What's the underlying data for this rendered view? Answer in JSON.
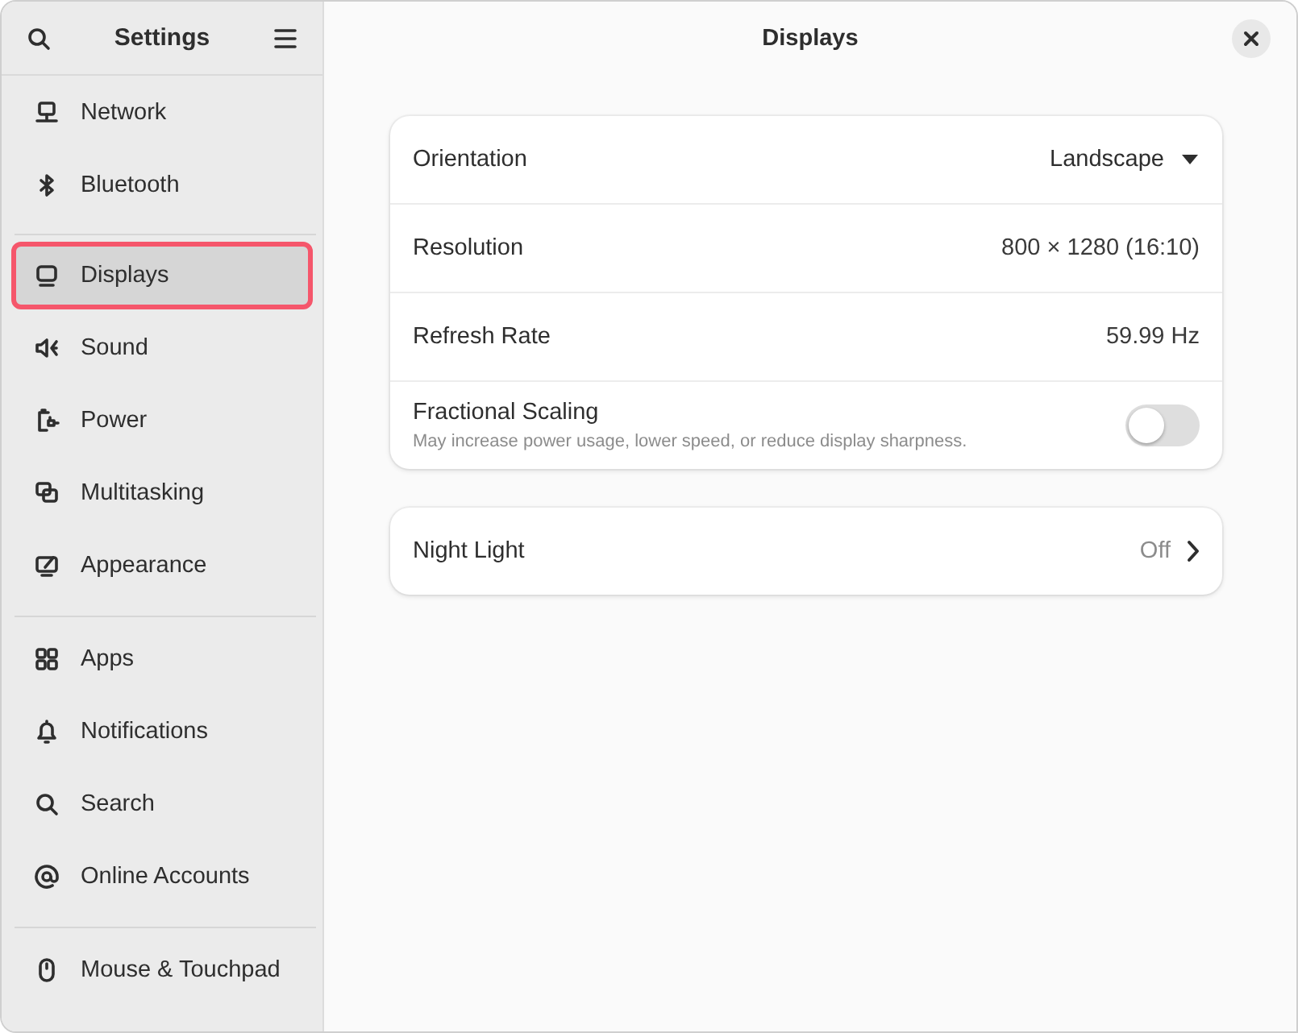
{
  "sidebar": {
    "title": "Settings",
    "groups": [
      {
        "items": [
          {
            "label": "Network",
            "selected": false
          },
          {
            "label": "Bluetooth",
            "selected": false
          }
        ]
      },
      {
        "items": [
          {
            "label": "Displays",
            "selected": true
          },
          {
            "label": "Sound",
            "selected": false
          },
          {
            "label": "Power",
            "selected": false
          },
          {
            "label": "Multitasking",
            "selected": false
          },
          {
            "label": "Appearance",
            "selected": false
          }
        ]
      },
      {
        "items": [
          {
            "label": "Apps",
            "selected": false
          },
          {
            "label": "Notifications",
            "selected": false
          },
          {
            "label": "Search",
            "selected": false
          },
          {
            "label": "Online Accounts",
            "selected": false
          }
        ]
      },
      {
        "items": [
          {
            "label": "Mouse & Touchpad",
            "selected": false
          }
        ]
      }
    ]
  },
  "content": {
    "title": "Displays",
    "cards": [
      {
        "rows": [
          {
            "kind": "dropdown",
            "label": "Orientation",
            "value": "Landscape"
          },
          {
            "kind": "value",
            "label": "Resolution",
            "value": "800 × 1280 (16:10)"
          },
          {
            "kind": "value",
            "label": "Refresh Rate",
            "value": "59.99 Hz"
          },
          {
            "kind": "switch",
            "label": "Fractional Scaling",
            "subtitle": "May increase power usage, lower speed, or reduce display sharpness.",
            "on": false
          }
        ]
      },
      {
        "rows": [
          {
            "kind": "link",
            "label": "Night Light",
            "value": "Off"
          }
        ]
      }
    ]
  }
}
